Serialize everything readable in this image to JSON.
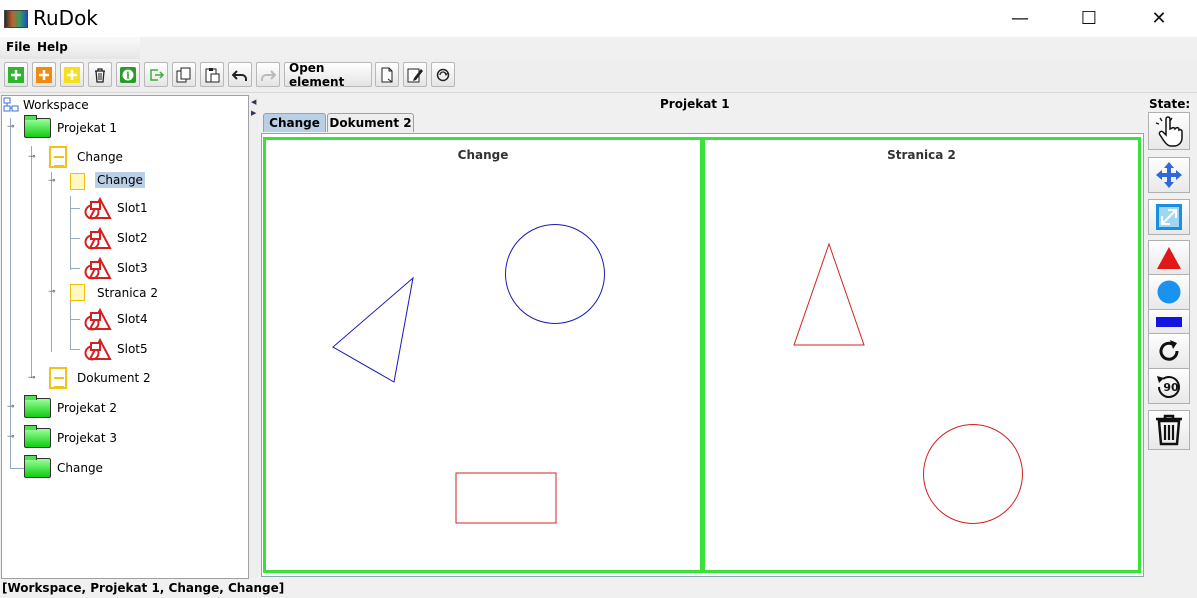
{
  "window": {
    "title": "RuDok",
    "minimize": "—",
    "maximize": "☐",
    "close": "✕"
  },
  "menu": {
    "file": "File",
    "help": "Help"
  },
  "toolbar": {
    "buttons": [
      "new-project",
      "new-document",
      "new-page",
      "delete",
      "info",
      "exit",
      "copy",
      "paste",
      "undo",
      "redo"
    ],
    "open_element": "Open element"
  },
  "tree": {
    "root": "Workspace",
    "nodes": [
      {
        "label": "Projekat 1",
        "type": "project",
        "level": 1
      },
      {
        "label": "Change",
        "type": "document",
        "level": 2
      },
      {
        "label": "Change",
        "type": "page",
        "level": 3,
        "selected": true
      },
      {
        "label": "Slot1",
        "type": "slot",
        "level": 4
      },
      {
        "label": "Slot2",
        "type": "slot",
        "level": 4
      },
      {
        "label": "Slot3",
        "type": "slot",
        "level": 4
      },
      {
        "label": "Stranica 2",
        "type": "page",
        "level": 3
      },
      {
        "label": "Slot4",
        "type": "slot",
        "level": 4
      },
      {
        "label": "Slot5",
        "type": "slot",
        "level": 4
      },
      {
        "label": "Dokument 2",
        "type": "document",
        "level": 2
      },
      {
        "label": "Projekat 2",
        "type": "project",
        "level": 1
      },
      {
        "label": "Projekat 3",
        "type": "project",
        "level": 1
      },
      {
        "label": "Change",
        "type": "project",
        "level": 1
      }
    ]
  },
  "main": {
    "project_title": "Projekat 1",
    "tabs": [
      {
        "label": "Change",
        "active": true
      },
      {
        "label": "Dokument 2",
        "active": false
      }
    ],
    "pages": [
      {
        "title": "Change"
      },
      {
        "title": "Stranica 2"
      }
    ]
  },
  "state_panel": {
    "label": "State:",
    "tools": [
      "select-state",
      "move-state",
      "resize-state",
      "triangle-state",
      "circle-state",
      "rectangle-state",
      "rotate-state",
      "rotate-90-state",
      "delete-state"
    ],
    "rotate_90_label": "90"
  },
  "colors": {
    "selection_border": "#3be13b",
    "blue_shape": "#1a1ab8",
    "red_shape": "#d42020"
  },
  "status": "[Workspace, Projekat 1, Change, Change]"
}
